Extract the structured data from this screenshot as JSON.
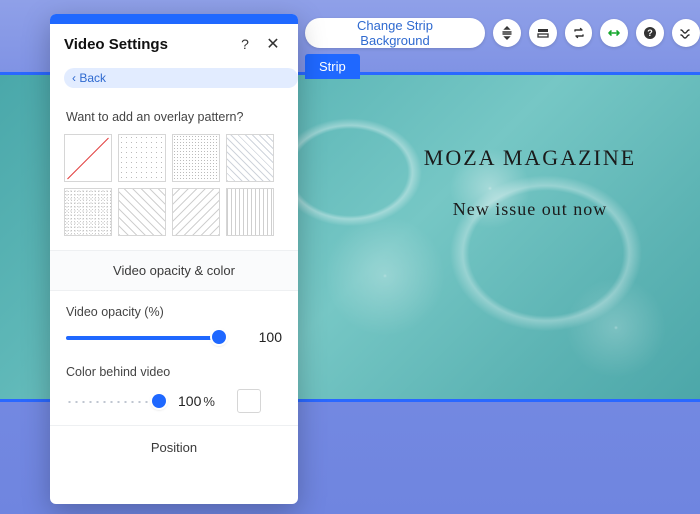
{
  "panel": {
    "title": "Video Settings",
    "back_label": "Back",
    "overlay_q": "Want to add an overlay pattern?",
    "section_opacity_color": "Video opacity & color",
    "opacity_label": "Video opacity (%)",
    "opacity_value": "100",
    "color_label": "Color behind video",
    "color_value": "100",
    "color_unit": "%",
    "section_position": "Position"
  },
  "toolbar": {
    "change_bg": "Change Strip Background",
    "strip_tab": "Strip"
  },
  "hero": {
    "title": "MOZA MAGAZINE",
    "subtitle": "New issue out now"
  }
}
